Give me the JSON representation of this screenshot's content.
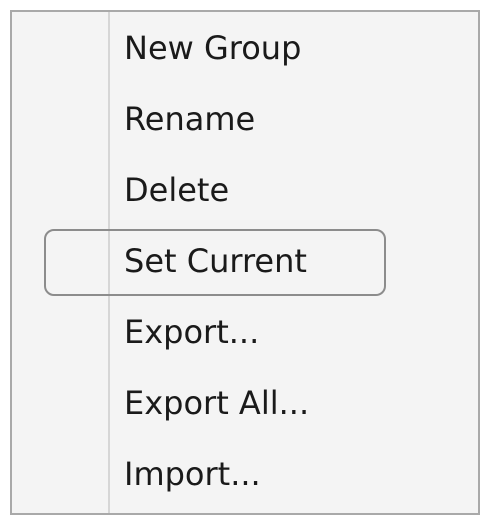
{
  "menu": {
    "items": [
      {
        "label": "New Group"
      },
      {
        "label": "Rename"
      },
      {
        "label": "Delete"
      },
      {
        "label": "Set Current",
        "highlighted": true
      },
      {
        "label": "Export..."
      },
      {
        "label": "Export All..."
      },
      {
        "label": "Import..."
      }
    ]
  }
}
